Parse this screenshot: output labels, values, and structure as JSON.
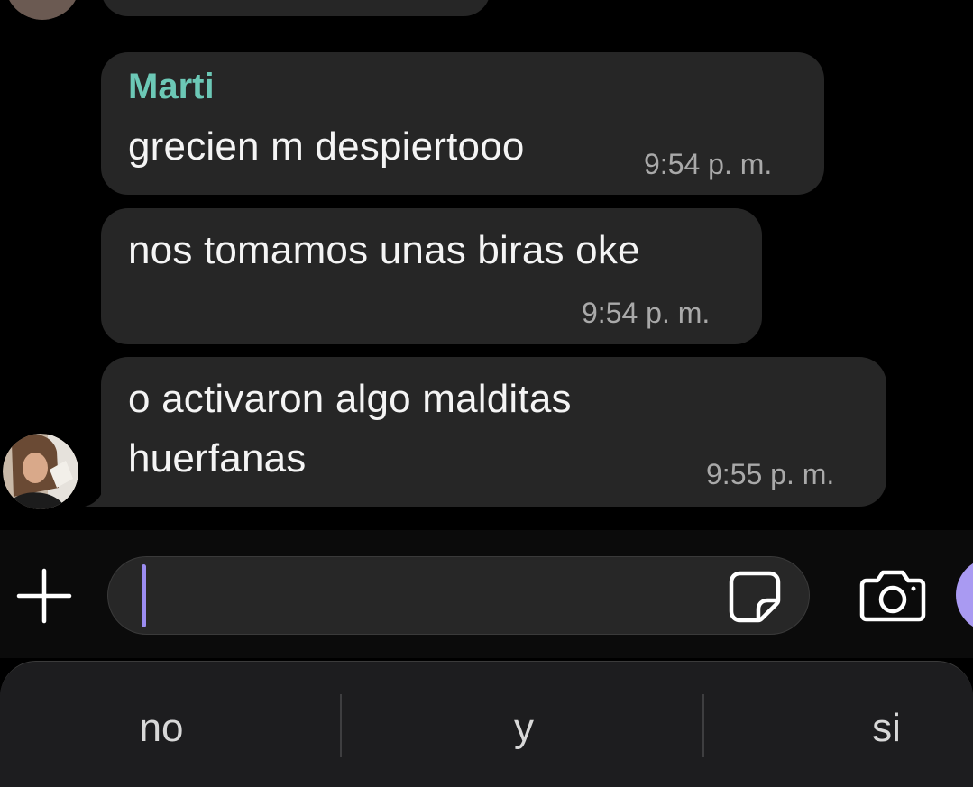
{
  "chat": {
    "messages": [
      {
        "sender": "Marti",
        "text": "grecien m despiertooo",
        "time": "9:54 p. m."
      },
      {
        "text": "nos tomamos unas biras oke",
        "time": "9:54 p. m."
      },
      {
        "text_line1": "o activaron algo malditas",
        "text_line2": "huerfanas",
        "time": "9:55 p. m."
      }
    ]
  },
  "composer": {
    "input_value": "",
    "accent_color": "#9b8cf0",
    "icons": [
      "plus-icon",
      "sticker-icon",
      "camera-icon",
      "voice-button"
    ]
  },
  "keyboard": {
    "suggestions": [
      "no",
      "y",
      "si"
    ]
  },
  "colors": {
    "background": "#000000",
    "bubble": "#262626",
    "sender_name": "#6cc8b6",
    "timestamp": "#a9a9a9"
  }
}
